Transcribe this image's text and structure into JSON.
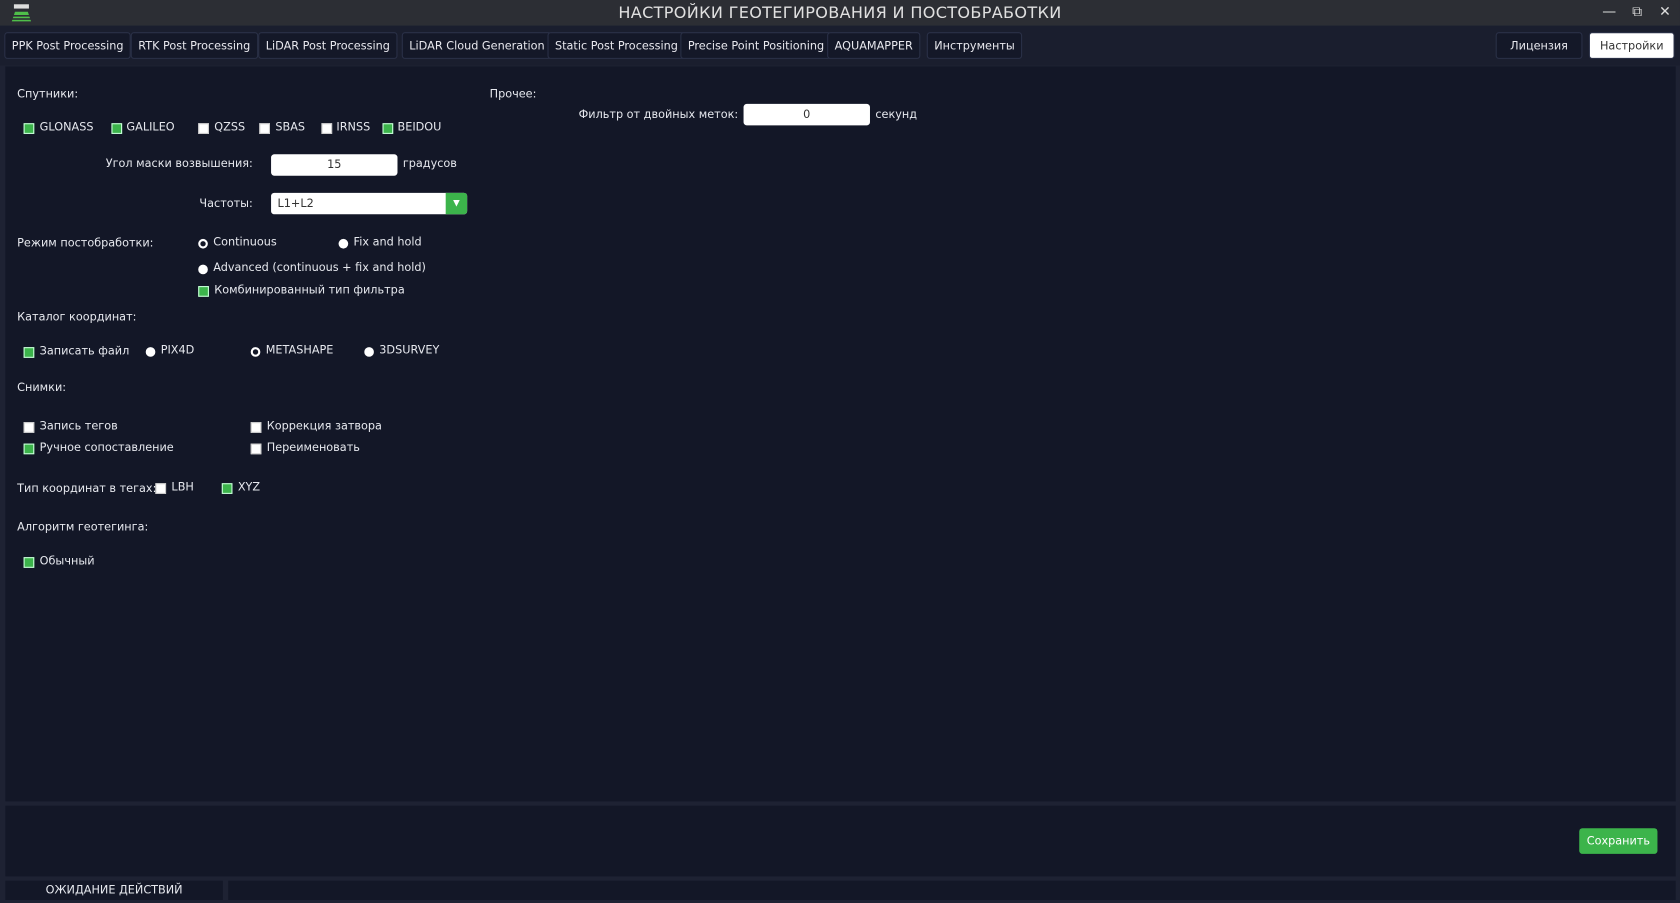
{
  "window": {
    "title": "НАСТРОЙКИ ГЕОТЕГИРОВАНИЯ И ПОСТОБРАБОТКИ",
    "minimize_icon": "minimize-icon",
    "restore_icon": "restore-icon",
    "close_icon": "close-icon"
  },
  "tabs": [
    "PPK Post Processing",
    "RTK Post Processing",
    "LiDAR Post Processing",
    "LiDAR Cloud Generation",
    "Static Post Processing",
    "Precise Point Positioning",
    "AQUAMAPPER",
    "Инструменты"
  ],
  "right_tabs": {
    "license": "Лицензия",
    "settings": "Настройки"
  },
  "satellites": {
    "label": "Спутники:",
    "items": [
      {
        "label": "GLONASS",
        "checked": true
      },
      {
        "label": "GALILEO",
        "checked": true
      },
      {
        "label": "QZSS",
        "checked": false
      },
      {
        "label": "SBAS",
        "checked": false
      },
      {
        "label": "IRNSS",
        "checked": false
      },
      {
        "label": "BEIDOU",
        "checked": true
      }
    ]
  },
  "elevation": {
    "label": "Угол маски возвышения:",
    "value": "15",
    "unit": "градусов"
  },
  "frequencies": {
    "label": "Частоты:",
    "value": "L1+L2"
  },
  "mode": {
    "label": "Режим постобработки:",
    "continuous": "Continuous",
    "fix_hold": "Fix and hold",
    "advanced": "Advanced (continuous + fix and hold)",
    "selected": "Continuous",
    "combined_filter": "Комбинированный тип фильтра",
    "combined_checked": true
  },
  "catalog": {
    "label": "Каталог координат:",
    "write_file": "Записать файл",
    "write_checked": true,
    "pix4d": "PIX4D",
    "metashape": "METASHAPE",
    "survey": "3DSURVEY",
    "selected": "METASHAPE"
  },
  "images": {
    "label": "Снимки:",
    "tag_write": "Запись тегов",
    "manual_match": "Ручное сопоставление",
    "shutter": "Коррекция затвора",
    "rename": "Переименовать"
  },
  "coord_type": {
    "label": "Тип координат в тегах:",
    "lbh": "LBH",
    "xyz": "XYZ"
  },
  "algorithm": {
    "label": "Алгоритм геотегинга:",
    "normal": "Обычный"
  },
  "other": {
    "label": "Прочее:",
    "filter_label": "Фильтр от двойных меток:",
    "filter_value": "0",
    "filter_unit": "секунд"
  },
  "footer": {
    "save": "Сохранить"
  },
  "status": {
    "text": "ОЖИДАНИЕ ДЕЙСТВИЙ"
  },
  "colors": {
    "accent": "#3cb44b",
    "background": "#131727"
  }
}
